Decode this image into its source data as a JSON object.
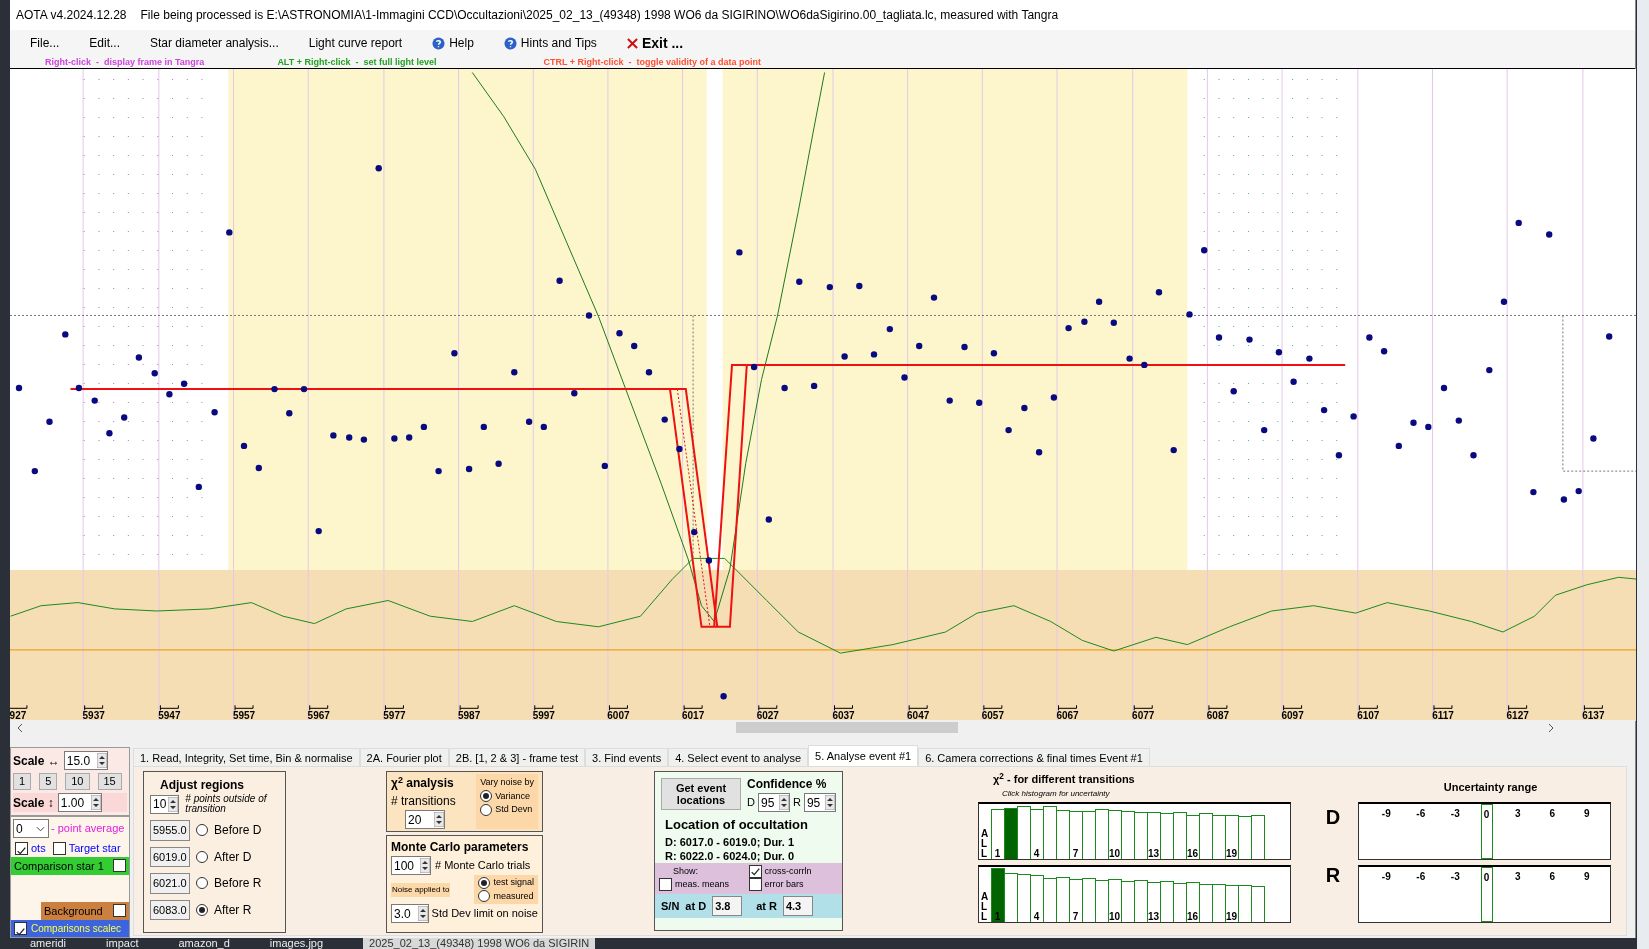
{
  "window": {
    "app": "AOTA v4.2024.12.28",
    "title": "File being processed is E:\\ASTRONOMIA\\1-Immagini CCD\\Occultazioni\\2025_02_13_(49348) 1998 WO6 da SIGIRINO\\WO6daSigirino.00_tagliata.lc, measured with Tangra"
  },
  "menu": [
    {
      "label": "File...",
      "kind": "plain"
    },
    {
      "label": "Edit...",
      "kind": "plain"
    },
    {
      "label": "Star diameter analysis...",
      "kind": "plain"
    },
    {
      "label": "Light curve report",
      "kind": "plain"
    },
    {
      "label": "Help",
      "kind": "help"
    },
    {
      "label": "Hints and Tips",
      "kind": "help"
    },
    {
      "label": "Exit ...",
      "kind": "exit"
    }
  ],
  "hints": [
    {
      "text": "Right-click  -  display frame in Tangra",
      "color": "#cc44dd"
    },
    {
      "text": "ALT + Right-click  -  set full light level",
      "color": "#22a022"
    },
    {
      "text": "CTRL + Right-click  -  toggle validity of a data point",
      "color": "#ff5030"
    }
  ],
  "plot": {
    "x_labels": [
      "927",
      "5937",
      "5947",
      "5957",
      "5967",
      "5977",
      "5987",
      "5997",
      "6007",
      "6017",
      "6027",
      "6037",
      "6047",
      "6057",
      "6067",
      "6077",
      "6087",
      "6097",
      "6107",
      "6117",
      "6127",
      "6137"
    ]
  },
  "scale_panel": {
    "h_label": "Scale ↔",
    "h_value": "15.0",
    "presets": [
      "1",
      "5",
      "10",
      "15"
    ],
    "v_label": "Scale ↕",
    "v_value": "1.00",
    "average_value": "0",
    "average_label": "- point average",
    "series": [
      {
        "kind": "text",
        "label": "ots",
        "checked": true
      },
      {
        "kind": "text",
        "label": "Target star",
        "checked": false
      },
      {
        "kind": "band",
        "label": "Comparison star 1",
        "color": "#33cc33",
        "checked": false
      },
      {
        "kind": "band",
        "label": "Background",
        "color": "#cc8040",
        "checked": false
      },
      {
        "kind": "band",
        "label": "Comparisons scalec",
        "color": "#3c64e0",
        "checked": true
      }
    ]
  },
  "tabs": [
    {
      "label": "1.  Read, Integrity, Set time, Bin & normalise",
      "selected": false
    },
    {
      "label": "2A. Fourier plot",
      "selected": false
    },
    {
      "label": "2B. [1, 2 & 3] - frame test",
      "selected": false
    },
    {
      "label": "3. Find events",
      "selected": false
    },
    {
      "label": "4. Select event to analyse",
      "selected": false
    },
    {
      "label": "5. Analyse event #1",
      "selected": true
    },
    {
      "label": "6. Camera corrections & final times Event #1",
      "selected": false
    }
  ],
  "adjust": {
    "title": "Adjust regions",
    "points_value": "10",
    "points_label": "# points outside of transition",
    "regions": [
      {
        "value": "5955.0",
        "label": "Before D",
        "selected": false
      },
      {
        "value": "6019.0",
        "label": "After D",
        "selected": false
      },
      {
        "value": "6021.0",
        "label": "Before R",
        "selected": false
      },
      {
        "value": "6083.0",
        "label": "After R",
        "selected": true
      }
    ]
  },
  "chi2": {
    "title": "χ$^{2}$ analysis",
    "transitions_label": "# transitions",
    "transitions_value": "20",
    "vary_title": "Vary noise by",
    "vary_options": [
      {
        "label": "Variance",
        "selected": true
      },
      {
        "label": "Std Devn",
        "selected": false
      }
    ]
  },
  "monte_carlo": {
    "title": "Monte Carlo parameters",
    "trials_value": "100",
    "trials_label": "# Monte Carlo trials",
    "noise_label": "Noise applied to",
    "noise_options": [
      {
        "label": "test signal",
        "selected": true
      },
      {
        "label": "measured",
        "selected": false
      }
    ],
    "limit_value": "3.0",
    "limit_label": "Std Dev limit on noise"
  },
  "event": {
    "button": "Get event locations",
    "confidence_title": "Confidence %",
    "d_label": "D",
    "d_value": "95",
    "r_label": "R",
    "r_value": "95",
    "location_title": "Location of occultation",
    "d_result": "D: 6017.0 - 6019.0; Dur. 1",
    "r_result": "R: 6022.0 - 6024.0; Dur. 0",
    "show_label": "Show:",
    "show_options": [
      {
        "label": "cross-corrln",
        "checked": true
      },
      {
        "label": "meas. means",
        "checked": false
      },
      {
        "label": "error bars",
        "checked": false
      }
    ],
    "sn_label": "S/N",
    "sn_d_label": "at D",
    "sn_d_value": "3.8",
    "sn_r_label": "at R",
    "sn_r_value": "4.3"
  },
  "histograms": {
    "title": "χ$^{2}$ - for different transitions",
    "hint": "Click histogram for uncertainty",
    "panels": [
      {
        "label": "D",
        "side_label": "ALL",
        "bars": [
          {
            "label": "1",
            "selected": false
          },
          {
            "selected": true
          },
          {
            "selected": false
          },
          {
            "label": "4",
            "selected": false
          },
          {
            "selected": false
          },
          {
            "selected": false
          },
          {
            "label": "7",
            "selected": false
          },
          {
            "selected": false
          },
          {
            "selected": false
          },
          {
            "label": "10",
            "selected": false
          },
          {
            "selected": false
          },
          {
            "selected": false
          },
          {
            "label": "13",
            "selected": false
          },
          {
            "selected": false
          },
          {
            "selected": false
          },
          {
            "label": "16",
            "selected": false
          },
          {
            "selected": false
          },
          {
            "selected": false
          },
          {
            "label": "19",
            "selected": false
          },
          {
            "selected": false
          },
          {
            "selected": false
          }
        ]
      },
      {
        "label": "R",
        "side_label": "ALL",
        "bars": [
          {
            "label": "1",
            "selected": true
          },
          {
            "selected": false
          },
          {
            "selected": false
          },
          {
            "label": "4",
            "selected": false
          },
          {
            "selected": false
          },
          {
            "selected": false
          },
          {
            "label": "7",
            "selected": false
          },
          {
            "selected": false
          },
          {
            "selected": false
          },
          {
            "label": "10",
            "selected": false
          },
          {
            "selected": false
          },
          {
            "selected": false
          },
          {
            "label": "13",
            "selected": false
          },
          {
            "selected": false
          },
          {
            "selected": false
          },
          {
            "label": "16",
            "selected": false
          },
          {
            "selected": false
          },
          {
            "selected": false
          },
          {
            "label": "19",
            "selected": false
          },
          {
            "selected": false
          },
          {
            "selected": false
          }
        ]
      }
    ]
  },
  "uncertainty": {
    "title": "Uncertainty range",
    "panels": [
      {
        "ticks": [
          {
            "label": "-9",
            "marked": false
          },
          {
            "label": "-6",
            "marked": false
          },
          {
            "label": "-3",
            "marked": false
          },
          {
            "label": "0",
            "marked": true
          },
          {
            "label": "3",
            "marked": false
          },
          {
            "label": "6",
            "marked": false
          },
          {
            "label": "9",
            "marked": false
          }
        ]
      },
      {
        "ticks": [
          {
            "label": "-9",
            "marked": false
          },
          {
            "label": "-6",
            "marked": false
          },
          {
            "label": "-3",
            "marked": false
          },
          {
            "label": "0",
            "marked": true
          },
          {
            "label": "3",
            "marked": false
          },
          {
            "label": "6",
            "marked": false
          },
          {
            "label": "9",
            "marked": false
          }
        ]
      }
    ]
  },
  "taskbar": [
    "ameridi",
    "impact",
    "amazon_d",
    "images.jpg",
    "2025_02_13_(49348) 1998 WO6 da SIGIRIN"
  ]
}
